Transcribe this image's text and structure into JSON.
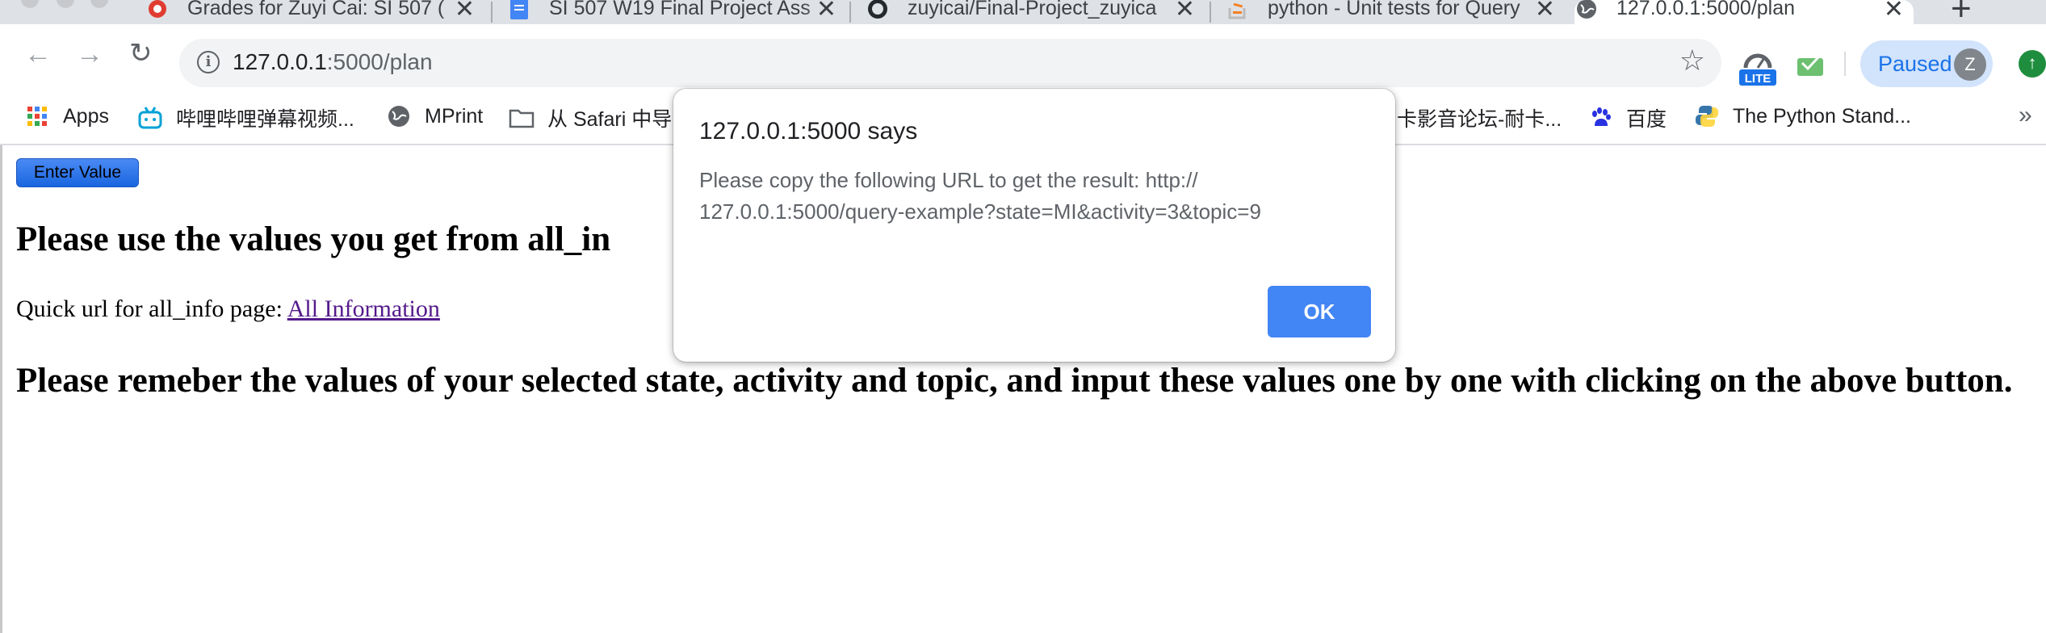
{
  "browser": {
    "tabs": [
      {
        "title": "Grades for Zuyi Cai: SI 507 (",
        "icon": "umich-block-m-icon",
        "active": false
      },
      {
        "title": "SI 507 W19 Final Project Ass",
        "icon": "google-docs-icon",
        "active": false
      },
      {
        "title": "zuyicai/Final-Project_zuyica",
        "icon": "github-icon",
        "active": false
      },
      {
        "title": "python - Unit tests for Query",
        "icon": "stackoverflow-icon",
        "active": false
      },
      {
        "title": "127.0.0.1:5000/plan",
        "icon": "globe-icon",
        "active": true
      }
    ],
    "new_tab_glyph": "+",
    "close_glyph": "✕",
    "address": {
      "host": "127.0.0.1",
      "path": ":5000/plan"
    },
    "profile": {
      "status": "Paused",
      "initial": "Z"
    },
    "lite_badge": "LITE",
    "bookmarks": [
      {
        "label": "Apps",
        "icon": "apps-grid-icon"
      },
      {
        "label": "哔哩哔哩弹幕视频...",
        "icon": "bilibili-icon"
      },
      {
        "label": "MPrint",
        "icon": "globe-icon"
      },
      {
        "label": "从 Safari 中导",
        "icon": "folder-icon"
      },
      {
        "label": "卡影音论坛-耐卡...",
        "icon": "none"
      },
      {
        "label": "百度",
        "icon": "baidu-paw-icon"
      },
      {
        "label": "The Python Stand...",
        "icon": "python-icon"
      }
    ],
    "bookmarks_more": "»"
  },
  "page": {
    "button_label": "Enter Value",
    "heading1": "Please use the values you get from all_in",
    "quick_prefix": "Quick url for all_info page: ",
    "quick_link": "All Information",
    "heading2": "Please remeber the values of your selected state, activity and topic, and input these values one by one with clicking on the above button."
  },
  "dialog": {
    "title": "127.0.0.1:5000 says",
    "message": "Please copy the following URL to get the result: http://127.0.0.1:5000/query-example?state=MI&activity=3&topic=9",
    "message_line1": "Please copy the following URL to get the result: http://",
    "message_line2": "127.0.0.1:5000/query-example?state=MI&activity=3&topic=9",
    "ok_label": "OK"
  },
  "colors": {
    "accent": "#1a73e8",
    "ok_button": "#4285f4",
    "tabstrip": "#dee1e6",
    "visited_link": "#551a8b"
  }
}
